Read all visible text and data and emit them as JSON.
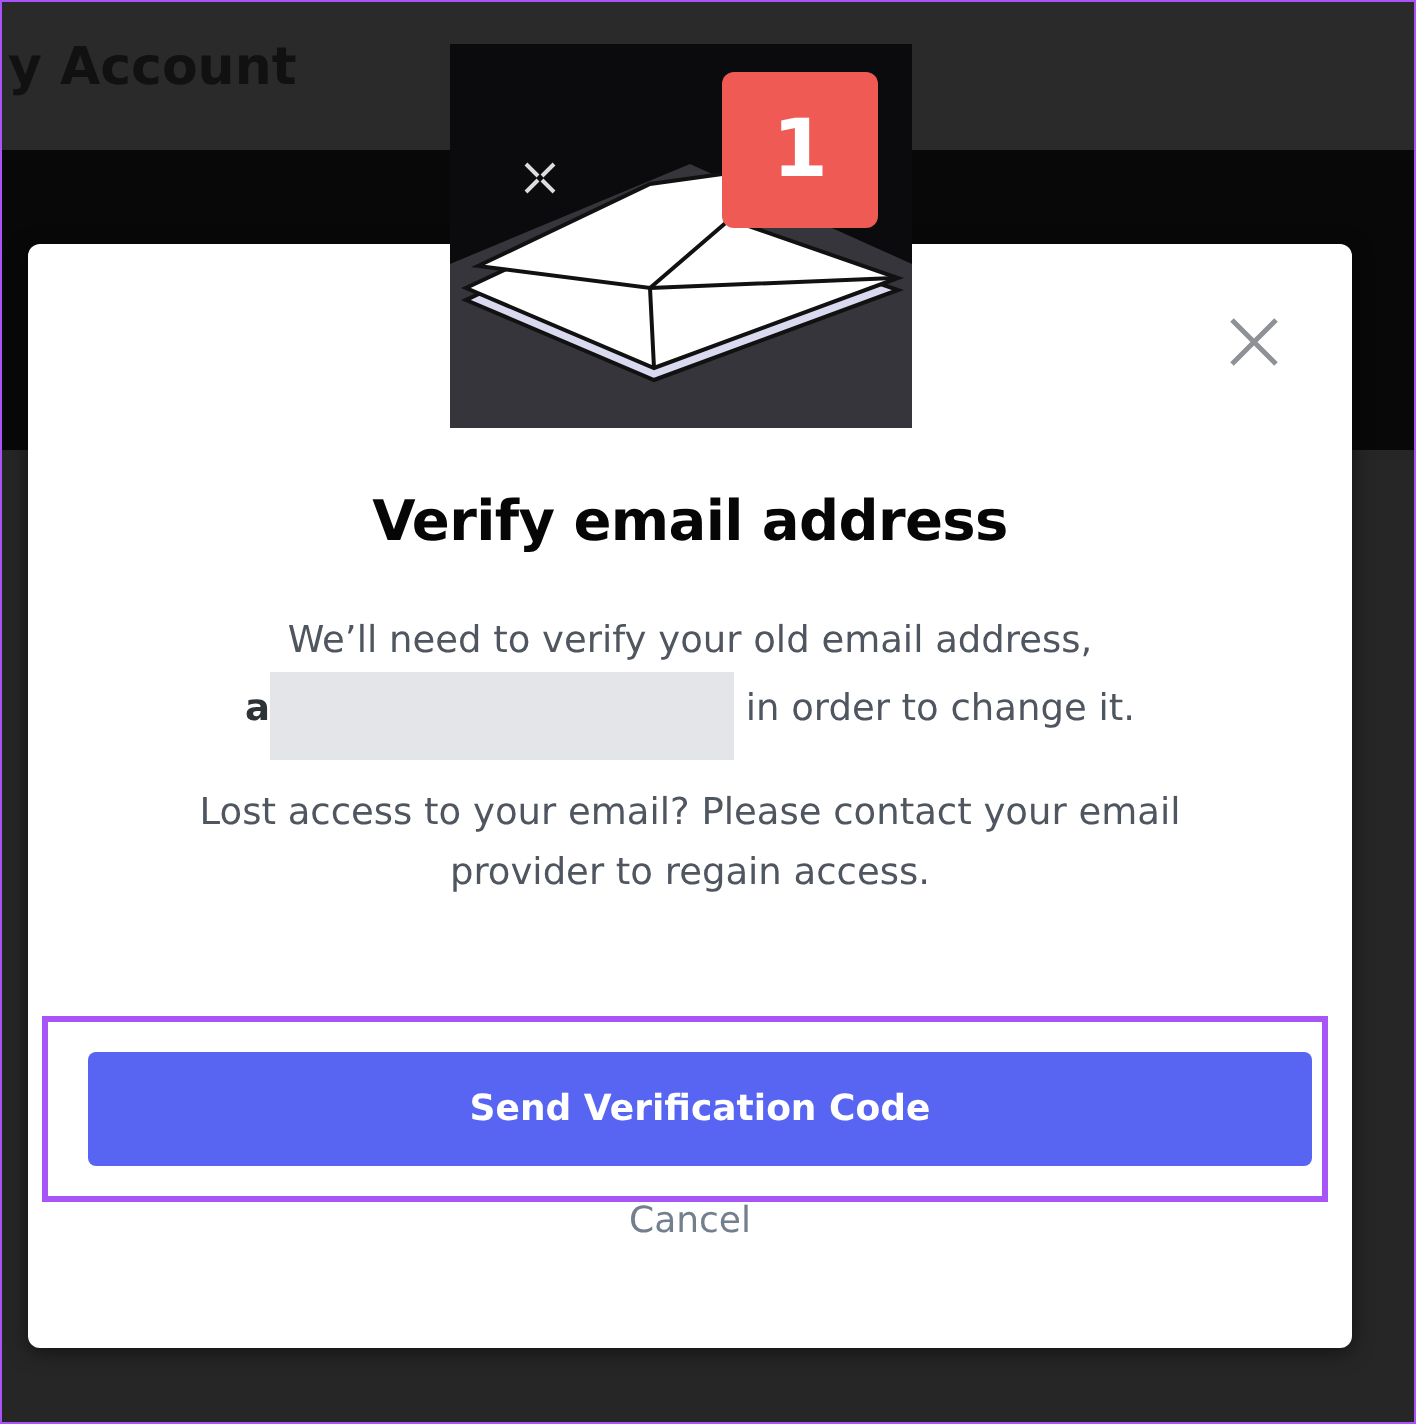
{
  "page": {
    "title": "y Account"
  },
  "notification": {
    "badge": "1"
  },
  "dialog": {
    "title": "Verify email address",
    "message_start": "We’ll need to verify your old email address,",
    "email_visible": "a",
    "email_redacted": true,
    "message_end": " in order to change it.",
    "help": "Lost access to your email? Please contact your email provider to regain access.",
    "primary_button": {
      "label": "Send Verification Code",
      "highlighted": true
    },
    "cancel": "Cancel"
  }
}
